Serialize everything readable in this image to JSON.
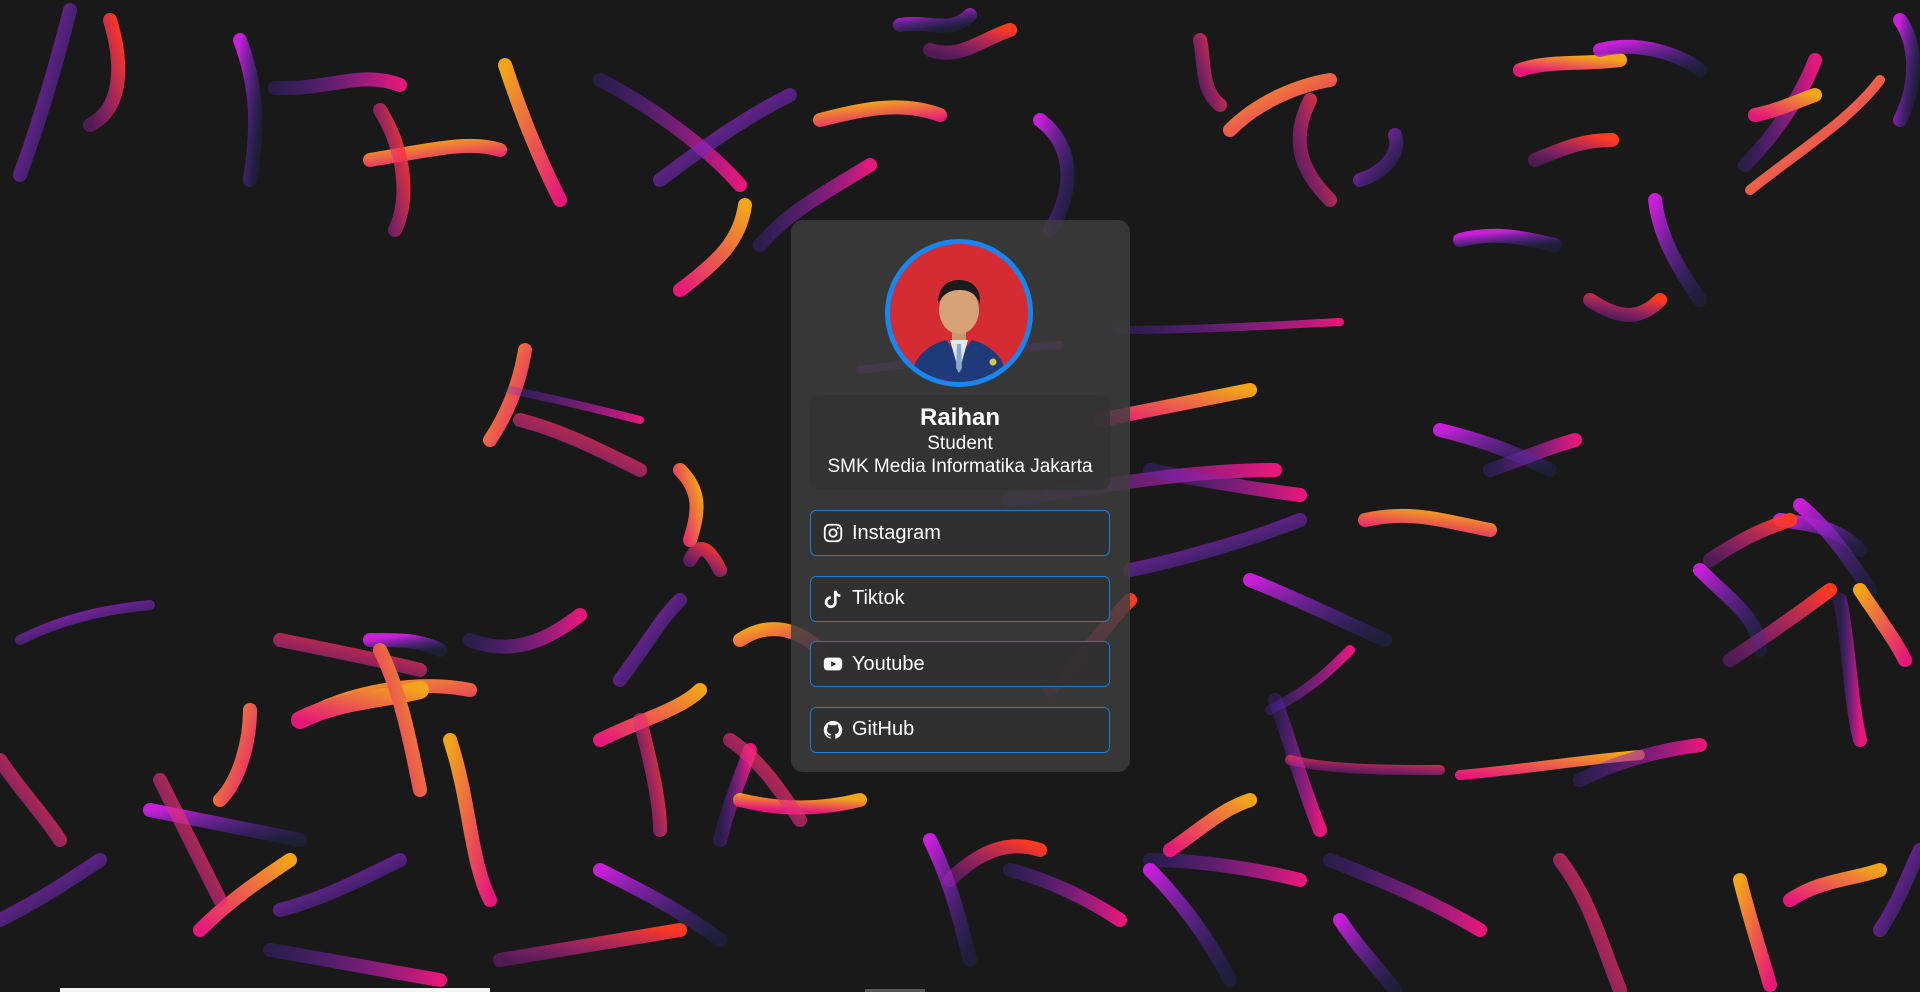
{
  "profile": {
    "name": "Raihan",
    "role": "Student",
    "school": "SMK Media Informatika Jakarta",
    "avatar_ring_color": "#1687f0"
  },
  "links": [
    {
      "label": "Instagram",
      "icon": "instagram-icon"
    },
    {
      "label": "Tiktok",
      "icon": "tiktok-icon"
    },
    {
      "label": "Youtube",
      "icon": "youtube-icon"
    },
    {
      "label": "GitHub",
      "icon": "github-icon"
    }
  ],
  "theme": {
    "background": "#1a1919",
    "accent": "#1d7ad7",
    "stroke_colors": [
      "#e5187a",
      "#c81fd8",
      "#5a28d8",
      "#ff3a1f",
      "#f2a51a",
      "#e8391f"
    ]
  }
}
